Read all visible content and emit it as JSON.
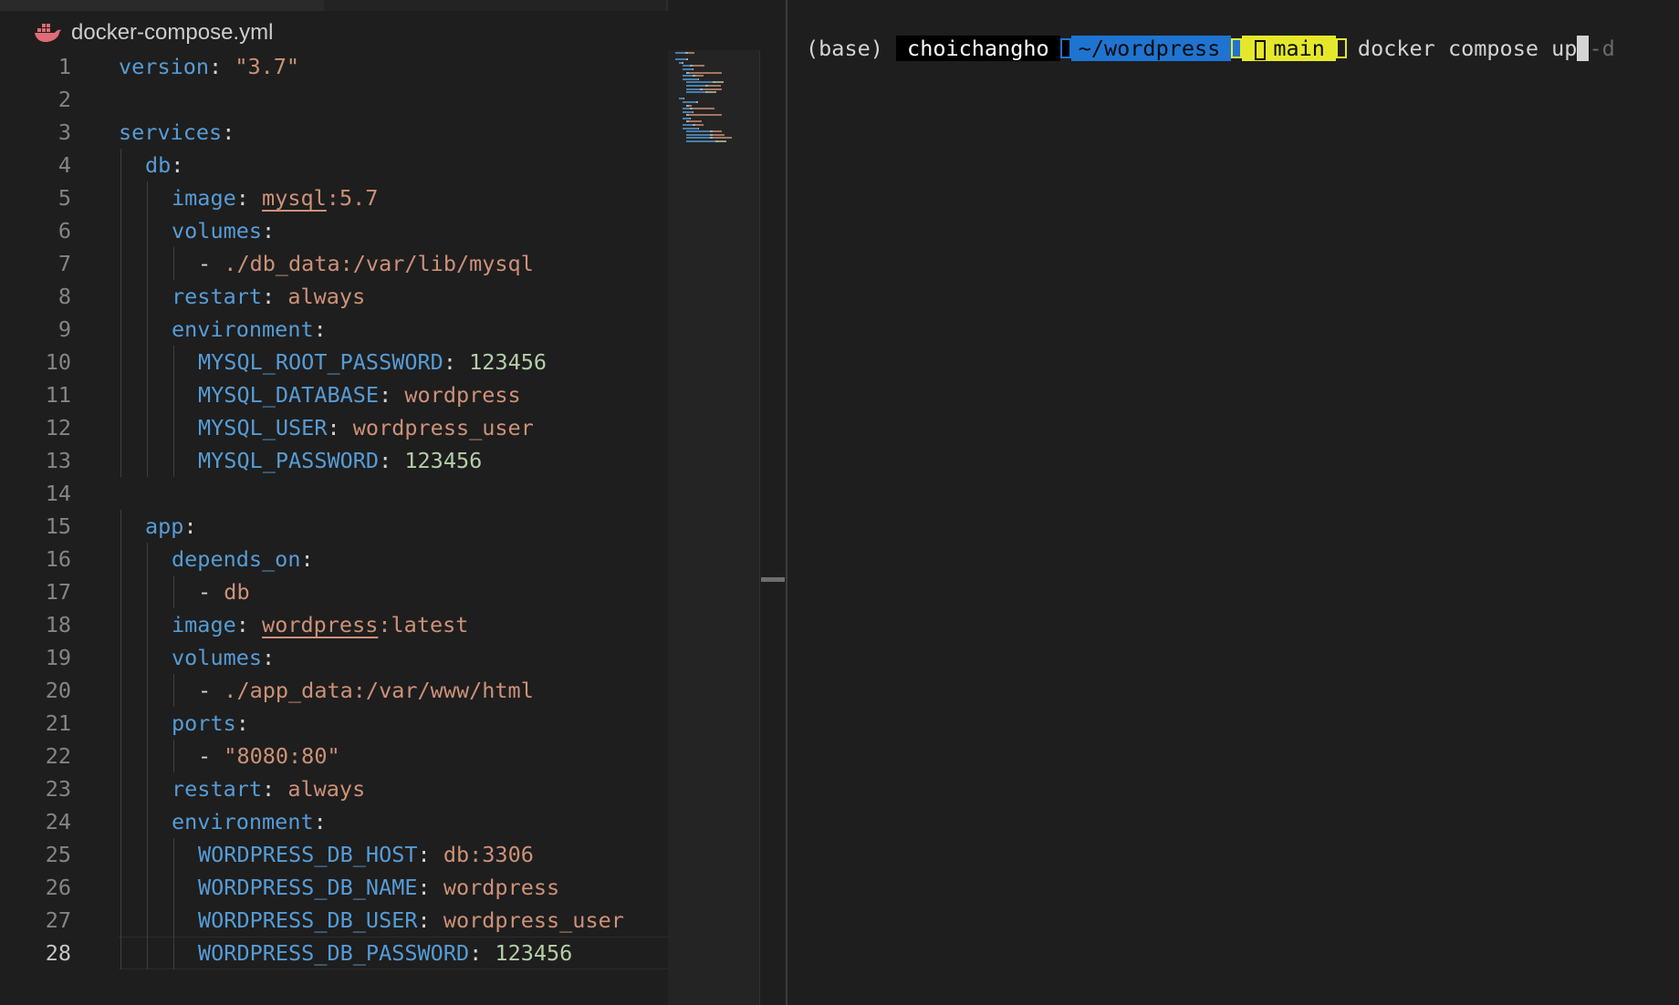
{
  "editor": {
    "tab": {
      "filename": "docker-compose.yml",
      "icon": "docker-whale-icon"
    },
    "current_line": 28,
    "lines": [
      {
        "n": "1",
        "ind": 0,
        "tokens": [
          {
            "t": "version",
            "c": "k"
          },
          {
            "t": ": ",
            "c": "p"
          },
          {
            "t": "\"3.7\"",
            "c": "s"
          }
        ]
      },
      {
        "n": "2",
        "ind": 0,
        "tokens": []
      },
      {
        "n": "3",
        "ind": 0,
        "tokens": [
          {
            "t": "services",
            "c": "k"
          },
          {
            "t": ":",
            "c": "p"
          }
        ]
      },
      {
        "n": "4",
        "ind": 1,
        "tokens": [
          {
            "t": "db",
            "c": "k"
          },
          {
            "t": ":",
            "c": "p"
          }
        ]
      },
      {
        "n": "5",
        "ind": 2,
        "tokens": [
          {
            "t": "image",
            "c": "k"
          },
          {
            "t": ": ",
            "c": "p"
          },
          {
            "t": "mysql",
            "c": "s u"
          },
          {
            "t": ":5.7",
            "c": "s"
          }
        ]
      },
      {
        "n": "6",
        "ind": 2,
        "tokens": [
          {
            "t": "volumes",
            "c": "k"
          },
          {
            "t": ":",
            "c": "p"
          }
        ]
      },
      {
        "n": "7",
        "ind": 3,
        "tokens": [
          {
            "t": "- ",
            "c": "p"
          },
          {
            "t": "./db_data:/var/lib/mysql",
            "c": "s"
          }
        ]
      },
      {
        "n": "8",
        "ind": 2,
        "tokens": [
          {
            "t": "restart",
            "c": "k"
          },
          {
            "t": ": ",
            "c": "p"
          },
          {
            "t": "always",
            "c": "s"
          }
        ]
      },
      {
        "n": "9",
        "ind": 2,
        "tokens": [
          {
            "t": "environment",
            "c": "k"
          },
          {
            "t": ":",
            "c": "p"
          }
        ]
      },
      {
        "n": "10",
        "ind": 3,
        "tokens": [
          {
            "t": "MYSQL_ROOT_PASSWORD",
            "c": "k"
          },
          {
            "t": ": ",
            "c": "p"
          },
          {
            "t": "123456",
            "c": "n"
          }
        ]
      },
      {
        "n": "11",
        "ind": 3,
        "tokens": [
          {
            "t": "MYSQL_DATABASE",
            "c": "k"
          },
          {
            "t": ": ",
            "c": "p"
          },
          {
            "t": "wordpress",
            "c": "s"
          }
        ]
      },
      {
        "n": "12",
        "ind": 3,
        "tokens": [
          {
            "t": "MYSQL_USER",
            "c": "k"
          },
          {
            "t": ": ",
            "c": "p"
          },
          {
            "t": "wordpress_user",
            "c": "s"
          }
        ]
      },
      {
        "n": "13",
        "ind": 3,
        "tokens": [
          {
            "t": "MYSQL_PASSWORD",
            "c": "k"
          },
          {
            "t": ": ",
            "c": "p"
          },
          {
            "t": "123456",
            "c": "n"
          }
        ]
      },
      {
        "n": "14",
        "ind": 0,
        "tokens": []
      },
      {
        "n": "15",
        "ind": 1,
        "tokens": [
          {
            "t": "app",
            "c": "k"
          },
          {
            "t": ":",
            "c": "p"
          }
        ]
      },
      {
        "n": "16",
        "ind": 2,
        "tokens": [
          {
            "t": "depends_on",
            "c": "k"
          },
          {
            "t": ":",
            "c": "p"
          }
        ]
      },
      {
        "n": "17",
        "ind": 3,
        "tokens": [
          {
            "t": "- ",
            "c": "p"
          },
          {
            "t": "db",
            "c": "s"
          }
        ]
      },
      {
        "n": "18",
        "ind": 2,
        "tokens": [
          {
            "t": "image",
            "c": "k"
          },
          {
            "t": ": ",
            "c": "p"
          },
          {
            "t": "wordpress",
            "c": "s u"
          },
          {
            "t": ":latest",
            "c": "s"
          }
        ]
      },
      {
        "n": "19",
        "ind": 2,
        "tokens": [
          {
            "t": "volumes",
            "c": "k"
          },
          {
            "t": ":",
            "c": "p"
          }
        ]
      },
      {
        "n": "20",
        "ind": 3,
        "tokens": [
          {
            "t": "- ",
            "c": "p"
          },
          {
            "t": "./app_data:/var/www/html",
            "c": "s"
          }
        ]
      },
      {
        "n": "21",
        "ind": 2,
        "tokens": [
          {
            "t": "ports",
            "c": "k"
          },
          {
            "t": ":",
            "c": "p"
          }
        ]
      },
      {
        "n": "22",
        "ind": 3,
        "tokens": [
          {
            "t": "- ",
            "c": "p"
          },
          {
            "t": "\"8080:80\"",
            "c": "s"
          }
        ]
      },
      {
        "n": "23",
        "ind": 2,
        "tokens": [
          {
            "t": "restart",
            "c": "k"
          },
          {
            "t": ": ",
            "c": "p"
          },
          {
            "t": "always",
            "c": "s"
          }
        ]
      },
      {
        "n": "24",
        "ind": 2,
        "tokens": [
          {
            "t": "environment",
            "c": "k"
          },
          {
            "t": ":",
            "c": "p"
          }
        ]
      },
      {
        "n": "25",
        "ind": 3,
        "tokens": [
          {
            "t": "WORDPRESS_DB_HOST",
            "c": "k"
          },
          {
            "t": ": ",
            "c": "p"
          },
          {
            "t": "db:3306",
            "c": "s"
          }
        ]
      },
      {
        "n": "26",
        "ind": 3,
        "tokens": [
          {
            "t": "WORDPRESS_DB_NAME",
            "c": "k"
          },
          {
            "t": ": ",
            "c": "p"
          },
          {
            "t": "wordpress",
            "c": "s"
          }
        ]
      },
      {
        "n": "27",
        "ind": 3,
        "tokens": [
          {
            "t": "WORDPRESS_DB_USER",
            "c": "k"
          },
          {
            "t": ": ",
            "c": "p"
          },
          {
            "t": "wordpress_user",
            "c": "s"
          }
        ]
      },
      {
        "n": "28",
        "ind": 3,
        "tokens": [
          {
            "t": "WORDPRESS_DB_PASSWORD",
            "c": "k"
          },
          {
            "t": ": ",
            "c": "p"
          },
          {
            "t": "123456",
            "c": "n"
          }
        ]
      }
    ]
  },
  "terminal": {
    "env": "(base)",
    "user": "choichangho",
    "dir": "~/wordpress",
    "branch": "main",
    "command": "docker compose up",
    "suggestion": "-d"
  },
  "colors": {
    "background": "#1e1e1e",
    "key": "#569cd6",
    "string": "#ce9178",
    "number": "#b5cea8",
    "dir_segment": "#1f74d1",
    "branch_segment": "#e5e82a"
  }
}
